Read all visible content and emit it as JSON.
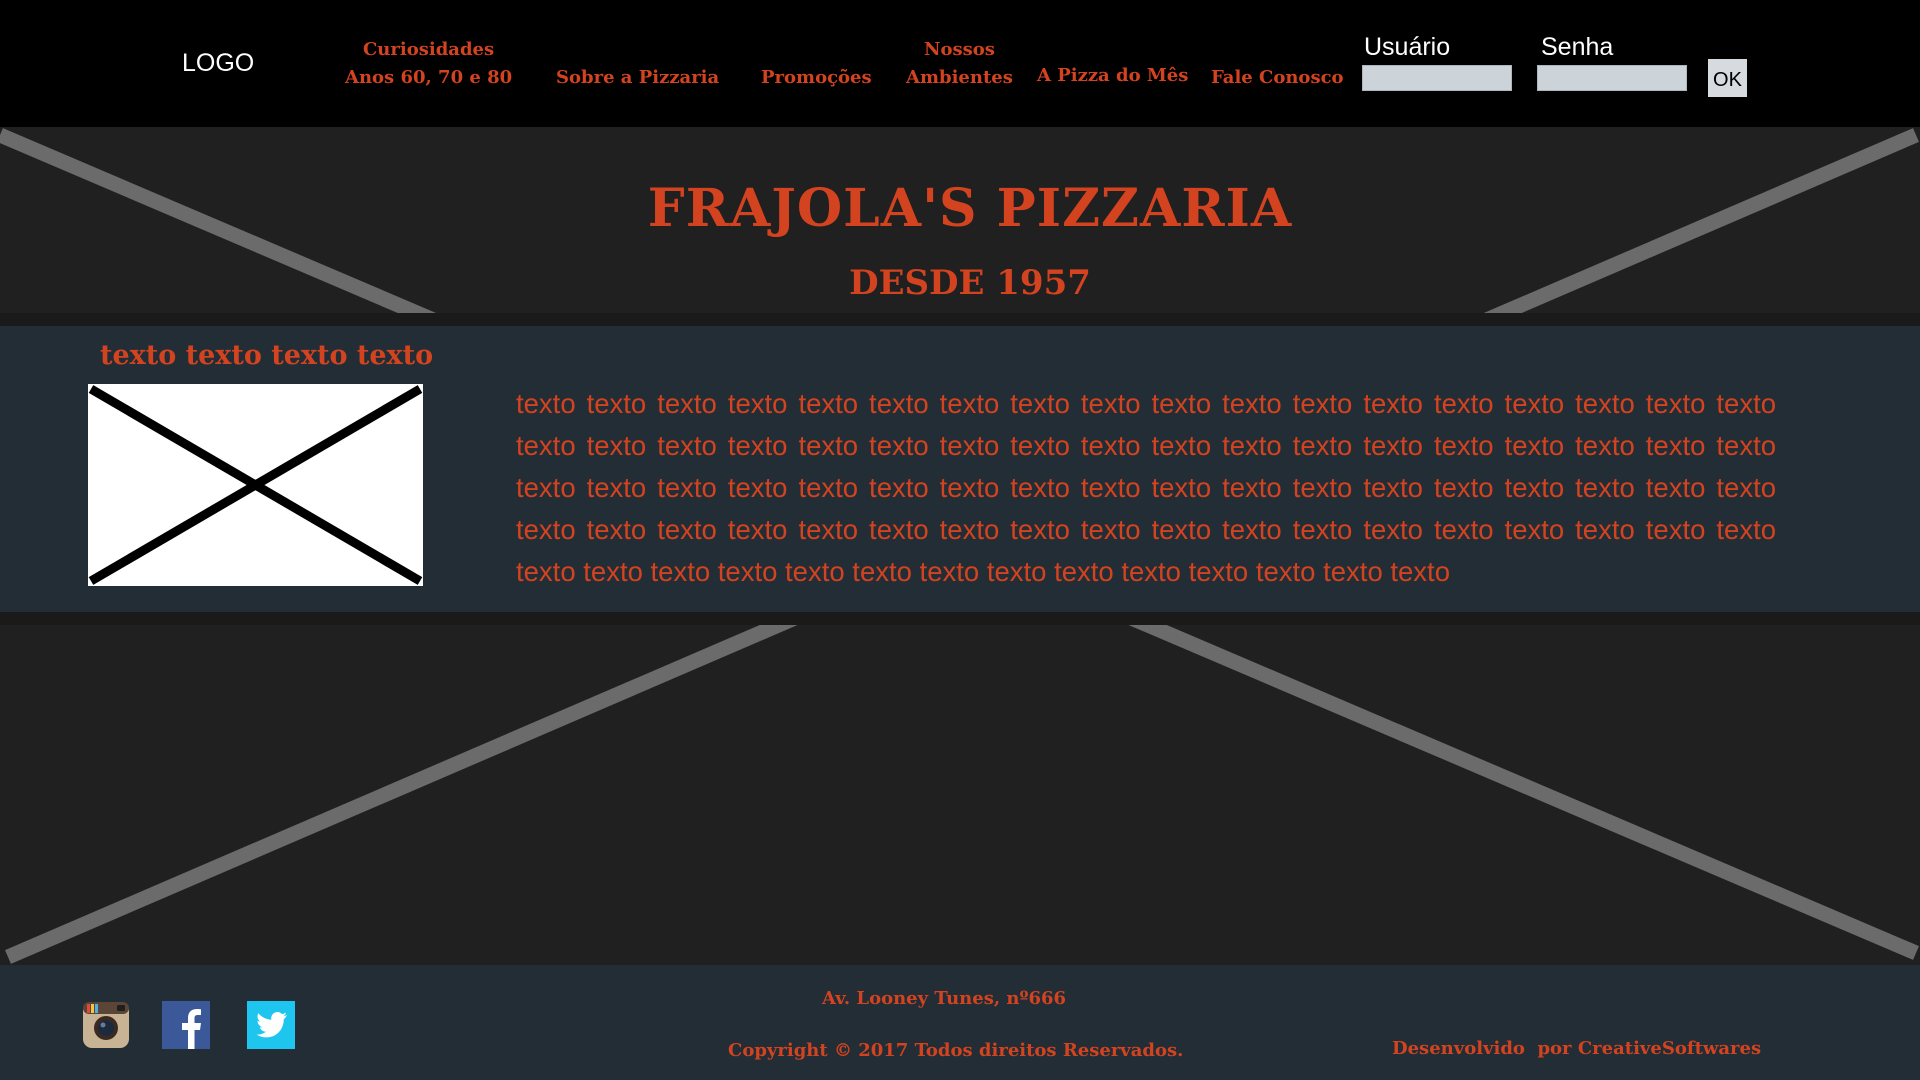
{
  "header": {
    "logo_text": "LOGO",
    "nav": [
      {
        "line1": "Curiosidades",
        "line2": "Anos 60, 70 e 80"
      },
      {
        "line1": "Sobre a Pizzaria"
      },
      {
        "line1": "Promoções"
      },
      {
        "line1": "Nossos",
        "line2": "Ambientes"
      },
      {
        "line1": "A Pizza do Mês"
      },
      {
        "line1": "Fale Conosco"
      }
    ],
    "login": {
      "user_label": "Usuário",
      "user_value": "",
      "password_label": "Senha",
      "password_value": "",
      "submit_label": "OK"
    }
  },
  "hero": {
    "title": "FRAJOLA'S PIZZARIA",
    "subtitle": "DESDE 1957"
  },
  "content": {
    "heading": "texto texto texto texto",
    "body": "texto texto texto texto texto texto texto texto texto texto texto texto texto texto texto texto texto texto texto texto texto texto texto texto texto texto texto texto texto texto texto texto texto texto texto texto texto texto texto texto texto texto texto texto texto texto texto texto texto texto texto texto texto texto texto texto texto texto texto texto texto texto texto texto texto texto texto texto texto texto texto texto texto texto texto texto texto texto texto texto texto texto texto texto texto texto"
  },
  "footer": {
    "address": "Av. Looney Tunes, nº666",
    "copyright": "Copyright © 2017 Todos direitos Reservados.",
    "developer_prefix": "Desenvolvido  por",
    "developer_name": "CreativeSoftwares",
    "social_icons": [
      "instagram-icon",
      "facebook-icon",
      "twitter-icon"
    ]
  },
  "colors": {
    "accent": "#d3431f",
    "nav_background": "#000000",
    "page_background": "#202020",
    "band_background": "#232d36",
    "input_background": "#ccd3d9"
  }
}
